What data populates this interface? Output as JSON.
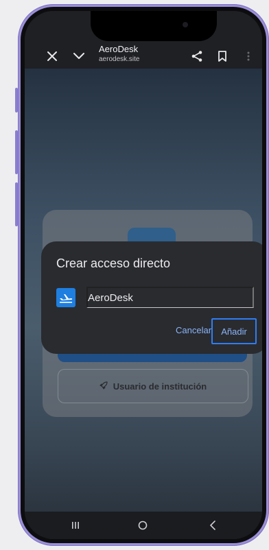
{
  "browser": {
    "title": "AeroDesk",
    "url": "aerodesk.site",
    "icons": {
      "close": "close-icon",
      "collapse": "chevron-down-icon",
      "share": "share-icon",
      "bookmark": "bookmark-icon",
      "more": "more-vert-icon"
    }
  },
  "background_page": {
    "institution_button_label": "Usuario de institución",
    "institution_icon": "rocket-icon"
  },
  "dialog": {
    "title": "Crear acceso directo",
    "app_icon": "plane-icon",
    "name_value": "AeroDesk",
    "cancel_label": "Cancelar",
    "add_label": "Añadir"
  },
  "navbar": {
    "recents_icon": "recents-icon",
    "home_icon": "home-icon",
    "back_icon": "back-icon"
  },
  "colors": {
    "frame": "#9b8fd6",
    "dialog_bg": "#2a2b2f",
    "accent_text": "#8ab4f8",
    "highlight_border": "#2e7ef7",
    "app_icon_bg": "#1e7fe0"
  }
}
